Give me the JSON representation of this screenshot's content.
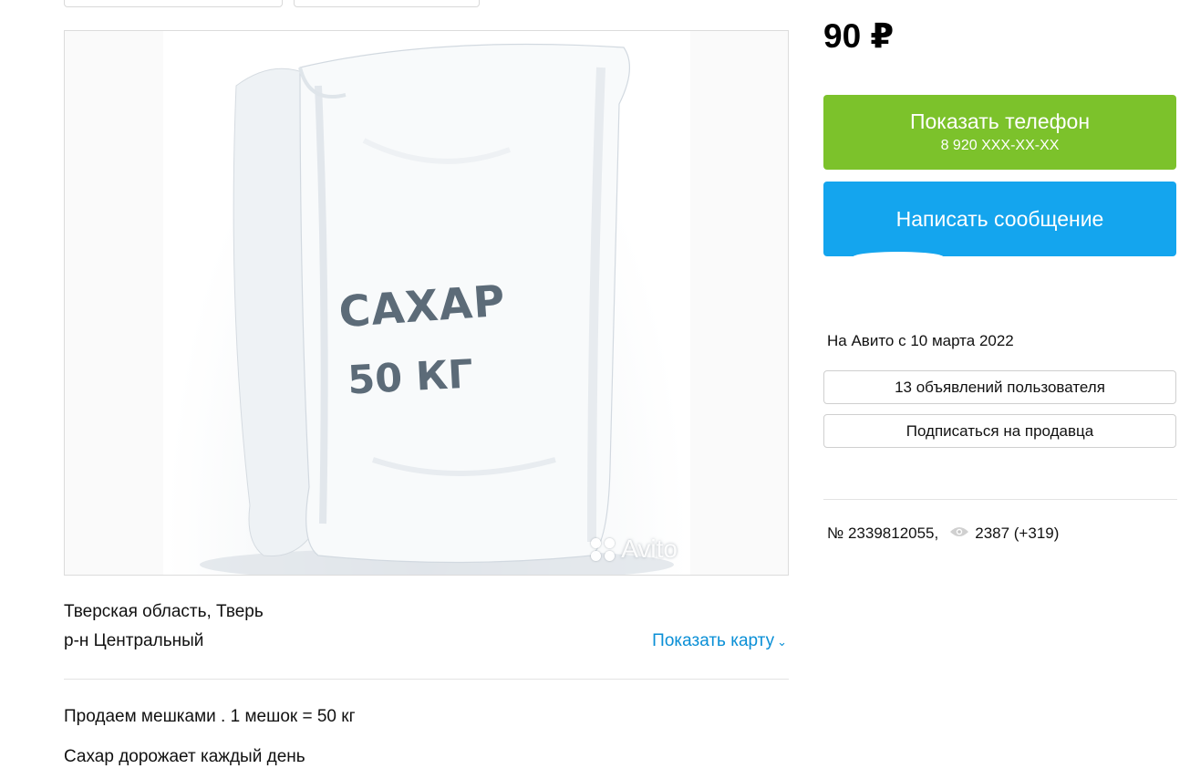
{
  "listing": {
    "price": "90 ₽",
    "photo": {
      "caption_line1": "САХАР",
      "caption_line2": "50 КГ",
      "watermark": "Avito"
    },
    "location": {
      "region_city": "Тверская область, Тверь",
      "district": "р-н Центральный",
      "show_map_label": "Показать карту"
    },
    "description": [
      "Продаем мешками . 1 мешок = 50 кг",
      "Сахар дорожает каждый день"
    ],
    "number": "№ 2339812055,",
    "views": "2387 (+319)"
  },
  "actions": {
    "show_phone_label": "Показать телефон",
    "phone_masked": "8 920 XXX-XX-XX",
    "write_message_label": "Написать сообщение"
  },
  "seller": {
    "since": "На Авито с 10 марта 2022",
    "listings_button": "13 объявлений пользователя",
    "subscribe_button": "Подписаться на продавца"
  },
  "colors": {
    "phone_button": "#7cc22b",
    "message_button": "#14a5ee",
    "link": "#0a8fd6"
  }
}
